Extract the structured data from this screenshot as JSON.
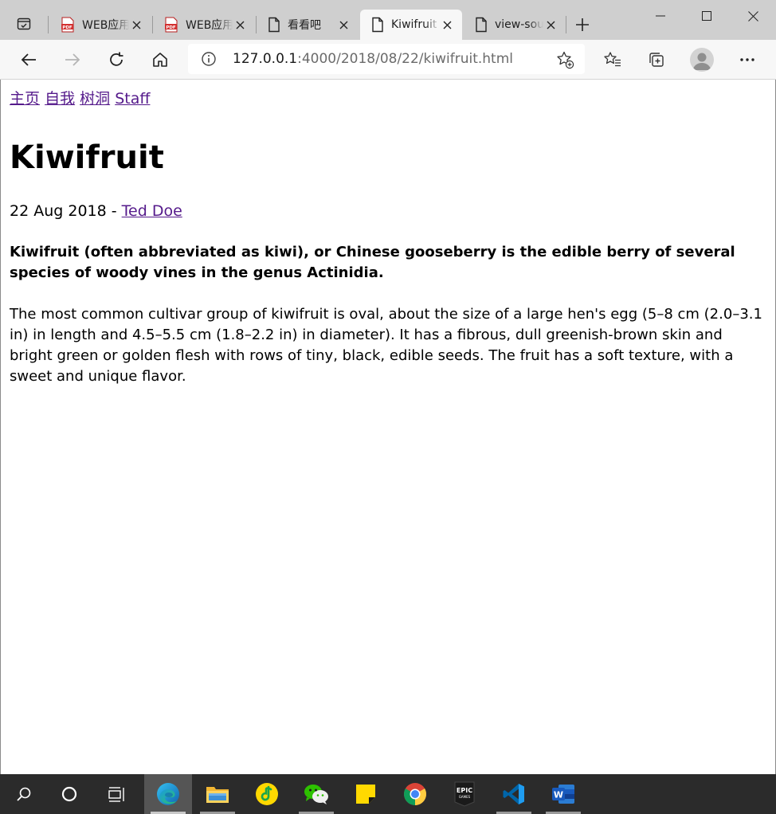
{
  "browser": {
    "tabs": [
      {
        "title": "WEB应用",
        "icon": "pdf-icon",
        "active": false
      },
      {
        "title": "WEB应用",
        "icon": "pdf-icon",
        "active": false
      },
      {
        "title": "看看吧",
        "icon": "page-icon",
        "active": false
      },
      {
        "title": "Kiwifruit",
        "icon": "page-icon",
        "active": true
      },
      {
        "title": "view-source",
        "icon": "page-icon",
        "active": false
      }
    ],
    "address": {
      "host": "127.0.0.1",
      "path": ":4000/2018/08/22/kiwifruit.html"
    }
  },
  "page": {
    "nav": [
      "主页",
      "自我",
      "树洞",
      "Staff"
    ],
    "title": "Kiwifruit",
    "date": "22 Aug 2018",
    "byline_sep": " - ",
    "author": "Ted Doe",
    "lead": "Kiwifruit (often abbreviated as kiwi), or Chinese gooseberry is the edible berry of several species of woody vines in the genus Actinidia.",
    "body": "The most common cultivar group of kiwifruit is oval, about the size of a large hen's egg (5–8 cm (2.0–3.1 in) in length and 4.5–5.5 cm (1.8–2.2 in) in diameter). It has a fibrous, dull greenish-brown skin and bright green or golden flesh with rows of tiny, black, edible seeds. The fruit has a soft texture, with a sweet and unique flavor."
  },
  "taskbar": {
    "apps": [
      "search-icon",
      "cortana-icon",
      "task-view-icon",
      "edge-icon",
      "file-explorer-icon",
      "qq-music-icon",
      "wechat-icon",
      "sticky-notes-icon",
      "chrome-icon",
      "epic-games-icon",
      "vscode-icon",
      "word-icon"
    ],
    "epic_label": "EPIC",
    "epic_sub": "GAMES",
    "word_label": "W"
  },
  "colors": {
    "link": "#551a8b",
    "chrome_bg": "#cfcfcf",
    "toolbar_bg": "#f7f7f7",
    "taskbar_bg": "#2b2b2b"
  }
}
